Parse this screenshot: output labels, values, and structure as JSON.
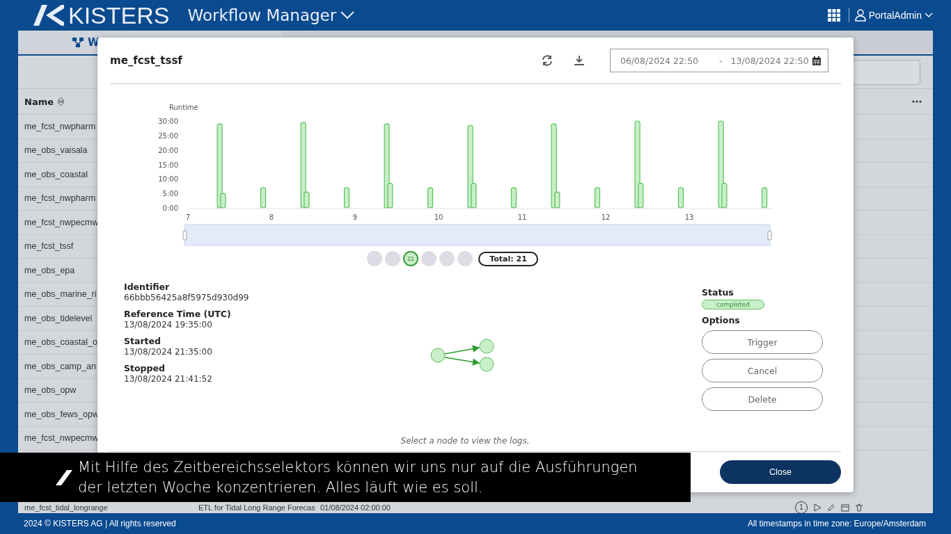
{
  "header": {
    "brand": "KISTERS",
    "app_title": "Workflow Manager",
    "user": "PortalAdmin"
  },
  "tabs": [
    {
      "label": "W",
      "selected": true
    }
  ],
  "table": {
    "columns": [
      "Name"
    ],
    "rows": [
      [
        "me_fcst_nwpharm"
      ],
      [
        "me_obs_vaisala"
      ],
      [
        "me_obs_coastal"
      ],
      [
        "me_fcst_nwpharm"
      ],
      [
        "me_fcst_nwpecmw"
      ],
      [
        "me_fcst_tssf"
      ],
      [
        "me_obs_epa"
      ],
      [
        "me_obs_marine_ri"
      ],
      [
        "me_obs_tidelevel"
      ],
      [
        "me_obs_coastal_o"
      ],
      [
        "me_obs_camp_an"
      ],
      [
        "me_obs_opw"
      ],
      [
        "me_obs_fews_opw"
      ],
      [
        "me_fcst_nwpecmw"
      ]
    ],
    "last_row": {
      "cells": [
        "me_fcst_tidal_longrange",
        "ETL for Tidal Long Range Forecas",
        "01/08/2024 02:00:00"
      ],
      "runs": "1"
    }
  },
  "dialog": {
    "title": "me_fcst_tssf",
    "range_start": "06/08/2024 22:50",
    "range_separator": "-",
    "range_end": "13/08/2024 22:50",
    "chart_data": {
      "type": "bar",
      "ylabel": "Runtime",
      "xlim": [
        7,
        14
      ],
      "ylim": [
        0,
        30
      ],
      "xticks": [
        7,
        8,
        9,
        10,
        11,
        12,
        13
      ],
      "yticks": [
        {
          "value": 0,
          "label": "0:00"
        },
        {
          "value": 5,
          "label": "5:00"
        },
        {
          "value": 10,
          "label": "10:00"
        },
        {
          "value": 15,
          "label": "15:00"
        },
        {
          "value": 20,
          "label": "20:00"
        },
        {
          "value": 25,
          "label": "25:00"
        },
        {
          "value": 30,
          "label": "30:00"
        }
      ],
      "x": [
        7.38,
        7.42,
        7.9,
        8.38,
        8.42,
        8.9,
        9.38,
        9.42,
        9.9,
        10.38,
        10.42,
        10.9,
        11.38,
        11.42,
        11.9,
        12.38,
        12.42,
        12.9,
        13.38,
        13.42,
        13.9
      ],
      "values": [
        29,
        5,
        7,
        29.5,
        5.5,
        7,
        29,
        8.5,
        7,
        28.5,
        8.5,
        7,
        29,
        5.5,
        7,
        30,
        8.5,
        7,
        30,
        8.5,
        7
      ]
    },
    "pager": [
      {
        "selected": false
      },
      {
        "selected": false
      },
      {
        "label": "21",
        "selected": true
      },
      {
        "selected": false
      },
      {
        "selected": false
      },
      {
        "selected": false
      }
    ],
    "total": "Total: 21",
    "details": [
      {
        "label": "Identifier",
        "value": "66bbb56425a8f5975d930d99"
      },
      {
        "label": "Reference Time (UTC)",
        "value": "13/08/2024 19:35:00"
      },
      {
        "label": "Started",
        "value": "13/08/2024 21:35:00"
      },
      {
        "label": "Stopped",
        "value": "13/08/2024 21:41:52"
      }
    ],
    "status_label": "Status",
    "status": "completed",
    "options_label": "Options",
    "options": [
      "Trigger",
      "Cancel",
      "Delete"
    ],
    "hint": "Select a node to view the logs.",
    "close": "Close"
  },
  "caption": [
    "Mit Hilfe des Zeitbereichsselektors können wir uns nur auf die Ausführungen",
    "der letzten Woche konzentrieren. Alles läuft wie es soll."
  ],
  "footer": {
    "left": "2024 © KISTERS AG | All rights reserved",
    "right": "All timestamps in time zone: Europe/Amsterdam"
  }
}
